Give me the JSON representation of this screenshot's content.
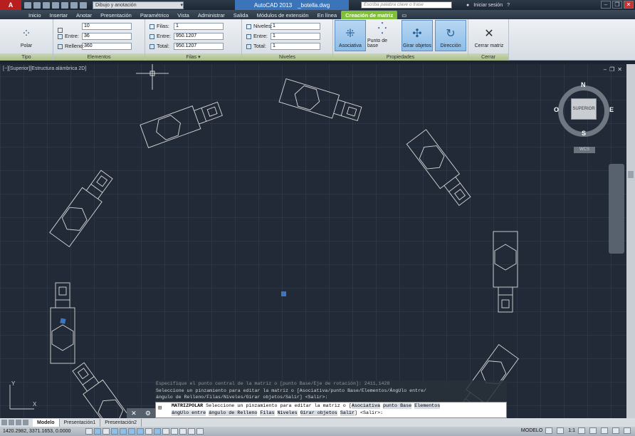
{
  "titlebar": {
    "app_letter": "A",
    "workspace": "Dibujo y anotación",
    "app_name": "AutoCAD 2013",
    "file_name": "_botella.dwg",
    "search_placeholder": "Escriba palabra clave o frase",
    "signin": "Iniciar sesión",
    "help": "?"
  },
  "tabs": [
    "Inicio",
    "Insertar",
    "Anotar",
    "Presentación",
    "Paramétrico",
    "Vista",
    "Administrar",
    "Salida",
    "Módulos de extensión",
    "En línea",
    "Creación de matriz"
  ],
  "ribbon": {
    "tipo": {
      "button": "Polar",
      "title": "Tipo"
    },
    "elementos": {
      "title": "Elementos",
      "fields": [
        {
          "label": "",
          "value": "10"
        },
        {
          "label": "Entre:",
          "value": "36"
        },
        {
          "label": "Relleno:",
          "value": "360"
        }
      ]
    },
    "filas": {
      "title": "Filas",
      "fields": [
        {
          "label": "Filas:",
          "value": "1"
        },
        {
          "label": "Entre:",
          "value": "950.1207"
        },
        {
          "label": "Total:",
          "value": "950.1207"
        }
      ]
    },
    "niveles": {
      "title": "Niveles",
      "fields": [
        {
          "label": "Niveles:",
          "value": "1"
        },
        {
          "label": "Entre:",
          "value": "1"
        },
        {
          "label": "Total:",
          "value": "1"
        }
      ]
    },
    "propiedades": {
      "title": "Propiedades",
      "buttons": [
        "Asociativa",
        "Punto de base",
        "Girar objetos",
        "Dirección"
      ]
    },
    "cerrar": {
      "title": "Cerrar",
      "button": "Cerrar matriz"
    }
  },
  "viewport": {
    "label": "[−][Superior][Estructura alámbrica 2D]",
    "viewcube": {
      "n": "N",
      "s": "S",
      "e": "E",
      "o": "O",
      "face": "SUPERIOR",
      "wcs": "WCS"
    }
  },
  "command": {
    "history": [
      "Especifique el punto central de la matriz o [punto Base/Eje de rotación]: 2411,1428",
      "Seleccione un pinzamiento para editar la matriz o [Asociativa/punto Base/Elementos/ÁngUlo entre/",
      "ángulo de Relleno/Filas/Niveles/Girar objetos/Salir] <Salir>:"
    ],
    "prompt_name": "MATRIZPOLAR",
    "prompt_text": "Seleccione un pinzamiento para editar la matriz o [",
    "options_line1": [
      "Asociativa",
      "punto Base",
      "Elementos"
    ],
    "options_line2": [
      "ángUlo entre",
      "ángulo de Relleno",
      "Filas",
      "Niveles",
      "Girar objetos",
      "Salir"
    ],
    "prompt_end": "<Salir>:"
  },
  "layout_tabs": [
    "Modelo",
    "Presentación1",
    "Presentación2"
  ],
  "status": {
    "coords": "1420.2982, 3371.1653, 0.0000",
    "space": "MODELO",
    "scale": "1:1"
  },
  "colors": {
    "accent_tab": "#7fbf39",
    "canvas": "#212a36",
    "geometry": "#dcdcdc"
  }
}
